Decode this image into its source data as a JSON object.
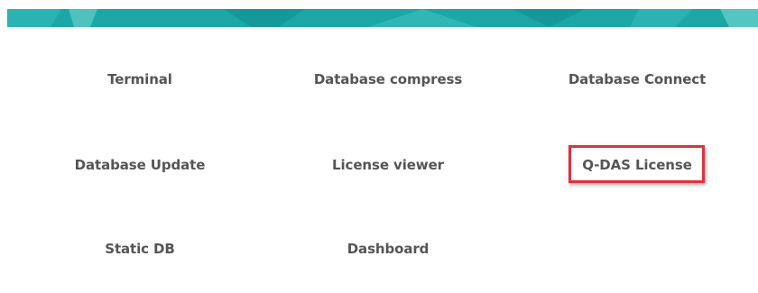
{
  "banner": {
    "color_primary": "#1aa7a6",
    "color_light": "#44bfbd",
    "color_dark": "#128f8f"
  },
  "tools": [
    {
      "id": "terminal",
      "label": "Terminal"
    },
    {
      "id": "database-compress",
      "label": "Database compress"
    },
    {
      "id": "database-connect",
      "label": "Database Connect"
    },
    {
      "id": "database-update",
      "label": "Database Update"
    },
    {
      "id": "license-viewer",
      "label": "License viewer"
    },
    {
      "id": "qdas-license",
      "label": "Q-DAS License",
      "highlighted": true
    },
    {
      "id": "static-db",
      "label": "Static DB"
    },
    {
      "id": "dashboard",
      "label": "Dashboard"
    }
  ],
  "highlight_color": "#e0323c"
}
